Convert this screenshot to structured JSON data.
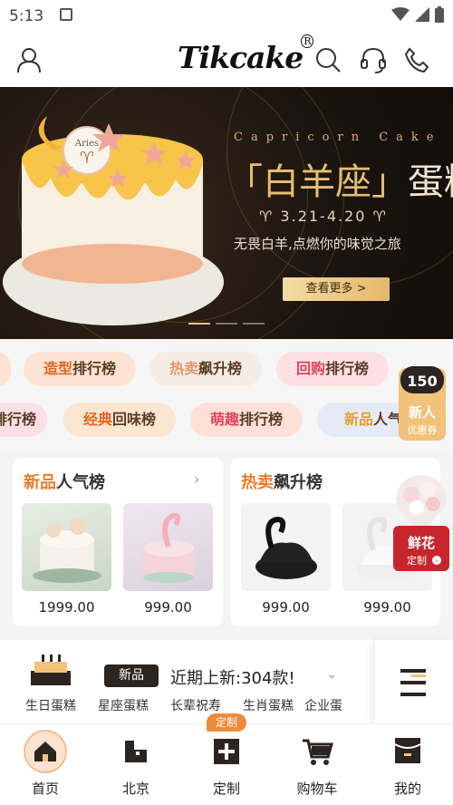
{
  "status_bar": {
    "time": "5:13"
  },
  "header": {
    "logo": "Tikcake",
    "logo_mark": "R",
    "icons": [
      "user-icon",
      "search-icon",
      "headset-icon",
      "phone-icon"
    ]
  },
  "banner": {
    "caption": "Capricorn Cake",
    "title_left": "「白羊座」",
    "title_right": "蛋糕",
    "date": "♈ 3.21-4.20 ♈",
    "subtitle": "无畏白羊,点燃你的味觉之旅",
    "button": "查看更多 >",
    "cake_label": "Aries",
    "active_slide": 1,
    "slides": 3
  },
  "chips_row1": [
    {
      "hl": "造型",
      "rest": "排行榜"
    },
    {
      "hl": "热卖",
      "rest": "飙升榜"
    },
    {
      "hl": "回购",
      "rest": "排行榜"
    }
  ],
  "chips_row2": [
    {
      "hl": "",
      "rest": "排行榜"
    },
    {
      "hl": "经典",
      "rest": "回味榜"
    },
    {
      "hl": "萌趣",
      "rest": "排行榜"
    },
    {
      "hl": "新品",
      "rest": "人气"
    }
  ],
  "promo_badge": {
    "amount": "150",
    "line1": "新人",
    "line2": "优惠券"
  },
  "cards": [
    {
      "title_hl": "新品",
      "title_rest": "人气榜",
      "products": [
        {
          "price": "1999.00"
        },
        {
          "price": "999.00"
        }
      ]
    },
    {
      "title_hl": "热卖",
      "title_rest": "飙升榜",
      "products": [
        {
          "price": "999.00"
        },
        {
          "price": "999.00"
        }
      ]
    }
  ],
  "flower_badge": {
    "title": "鲜花",
    "sub": "定制"
  },
  "categories": [
    "生日蛋糕",
    "星座蛋糕",
    "长辈祝寿",
    "生肖蛋糕",
    "企业蛋"
  ],
  "new_arrivals": {
    "badge": "新品",
    "text": "近期上新:304款!"
  },
  "tabs": [
    {
      "label": "首页",
      "icon": "home-icon"
    },
    {
      "label": "北京",
      "icon": "city-icon"
    },
    {
      "label": "定制",
      "icon": "customize-icon",
      "badge": "定制"
    },
    {
      "label": "购物车",
      "icon": "cart-icon"
    },
    {
      "label": "我的",
      "icon": "profile-icon"
    }
  ],
  "colors": {
    "accent": "#ec7b28",
    "dark": "#2b2420",
    "gold": "#e6bd6f"
  }
}
